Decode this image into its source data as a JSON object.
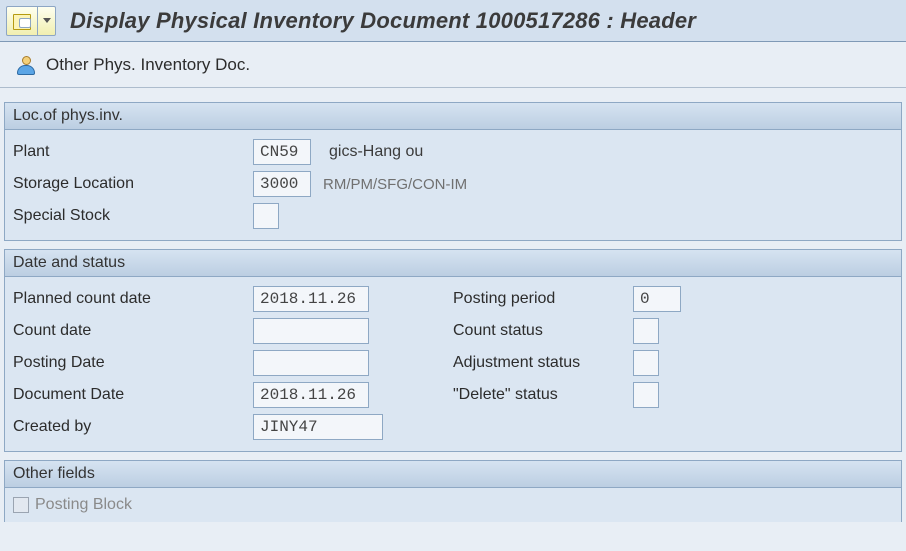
{
  "header": {
    "title": "Display Physical Inventory Document 1000517286 : Header"
  },
  "subbar": {
    "other_doc": "Other Phys. Inventory Doc."
  },
  "loc_panel": {
    "title": "Loc.of phys.inv.",
    "plant_label": "Plant",
    "plant_value": "CN59",
    "plant_desc": "        gics-Hang   ou",
    "sloc_label": "Storage Location",
    "sloc_value": "3000",
    "sloc_desc": "RM/PM/SFG/CON-IM",
    "special_label": "Special Stock",
    "special_value": ""
  },
  "date_panel": {
    "title": "Date and status",
    "planned_label": "Planned count date",
    "planned_value": "2018.11.26",
    "count_date_label": "Count date",
    "count_date_value": "",
    "posting_date_label": "Posting Date",
    "posting_date_value": "",
    "doc_date_label": "Document Date",
    "doc_date_value": "2018.11.26",
    "created_by_label": "Created by",
    "created_by_value": "JINY47",
    "posting_period_label": "Posting period",
    "posting_period_value": "0",
    "count_status_label": "Count status",
    "count_status_value": "",
    "adj_status_label": "Adjustment status",
    "adj_status_value": "",
    "delete_status_label": "\"Delete\" status",
    "delete_status_value": ""
  },
  "other_panel": {
    "title": "Other fields",
    "posting_block_label": "Posting Block"
  }
}
